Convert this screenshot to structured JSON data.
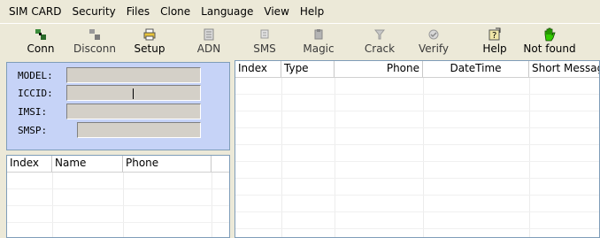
{
  "menu": [
    {
      "label": "SIM CARD",
      "key": "menu-sim-card"
    },
    {
      "label": "Security",
      "key": "menu-security"
    },
    {
      "label": "Files",
      "key": "menu-files"
    },
    {
      "label": "Clone",
      "key": "menu-clone"
    },
    {
      "label": "Language",
      "key": "menu-language"
    },
    {
      "label": "View",
      "key": "menu-view"
    },
    {
      "label": "Help",
      "key": "menu-help"
    }
  ],
  "toolbar": {
    "conn": "Conn",
    "disconn": "Disconn",
    "setup": "Setup",
    "adn": "ADN",
    "sms": "SMS",
    "magic": "Magic",
    "crack": "Crack",
    "verify": "Verify",
    "help": "Help",
    "notfound": "Not found"
  },
  "card_info": {
    "model_label": "MODEL:",
    "iccid_label": "ICCID:",
    "imsi_label": "IMSI:",
    "smsp_label": "SMSP:",
    "model_value": "",
    "iccid_value": "",
    "imsi_value": "",
    "smsp_value": ""
  },
  "phonebook": {
    "columns": [
      "Index",
      "Name",
      "Phone"
    ]
  },
  "messages": {
    "columns": [
      "Index",
      "Type",
      "Phone",
      "DateTime",
      "Short Message"
    ]
  },
  "colors": {
    "info_panel_bg": "#c6d3f7",
    "notfound_icon": "#33cc00"
  }
}
